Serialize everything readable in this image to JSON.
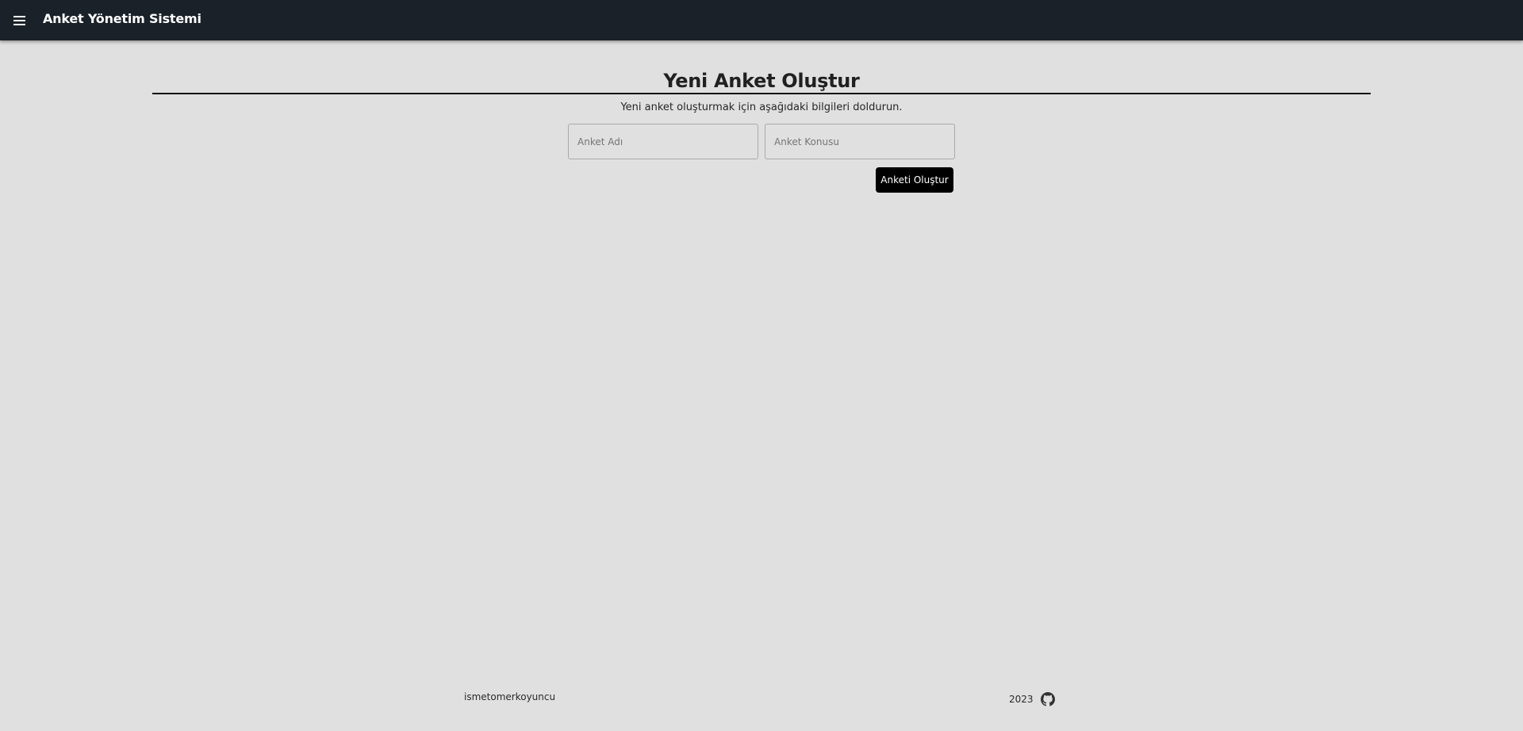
{
  "appbar": {
    "title": "Anket Yönetim Sistemi",
    "menu_icon": "hamburger-menu-icon"
  },
  "page": {
    "heading": "Yeni Anket Oluştur",
    "subtitle": "Yeni anket oluşturmak için aşağıdaki bilgileri doldurun."
  },
  "form": {
    "name_placeholder": "Anket Adı",
    "name_value": "",
    "topic_placeholder": "Anket Konusu",
    "topic_value": "",
    "submit_label": "Anketi Oluştur"
  },
  "footer": {
    "username": "ismetomerkoyuncu",
    "year": "2023",
    "github_icon": "github-icon"
  },
  "colors": {
    "appbar_bg": "#1b2129",
    "page_bg": "#e0e0e0",
    "button_bg": "#000000",
    "button_text": "#ffffff"
  }
}
